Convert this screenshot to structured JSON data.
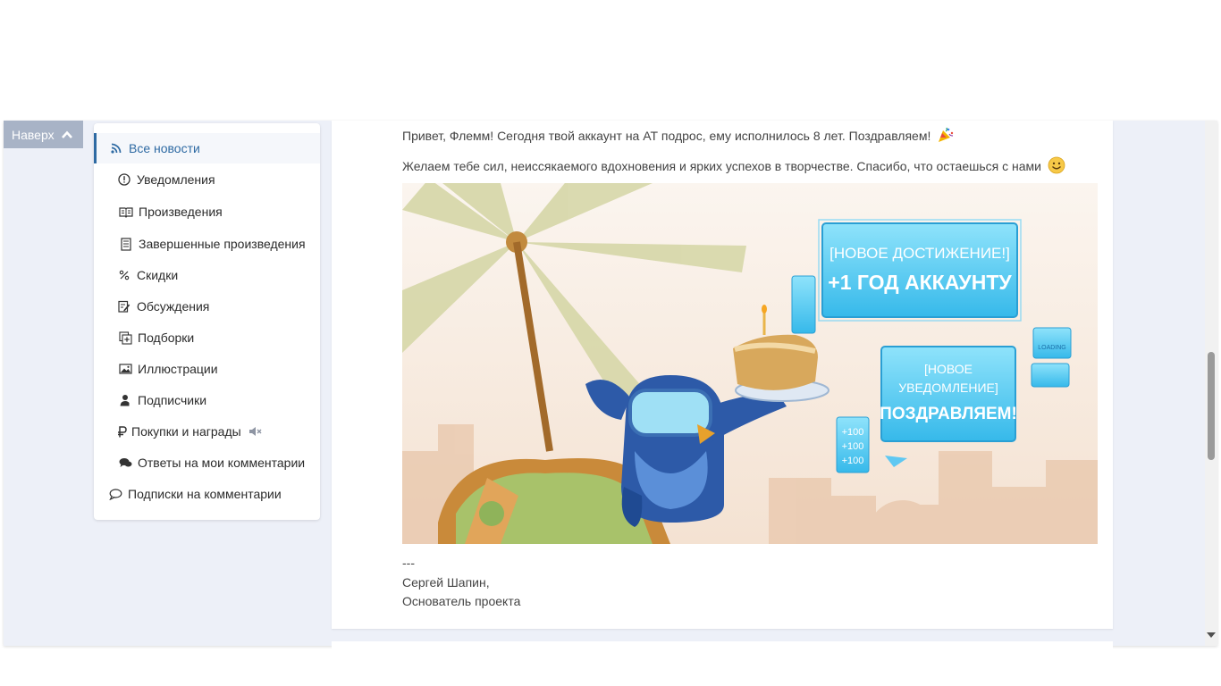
{
  "up_button": {
    "label": "Наверх"
  },
  "menu": {
    "items": [
      {
        "label": "Все новости",
        "icon": "rss-icon",
        "active": true
      },
      {
        "label": "Уведомления",
        "icon": "alert-circle-icon"
      },
      {
        "label": "Произведения",
        "icon": "open-book-icon"
      },
      {
        "label": "Завершенные произведения",
        "icon": "document-icon"
      },
      {
        "label": "Скидки",
        "icon": "percent-icon"
      },
      {
        "label": "Обсуждения",
        "icon": "edit-note-icon"
      },
      {
        "label": "Подборки",
        "icon": "collection-add-icon"
      },
      {
        "label": "Иллюстрации",
        "icon": "image-icon"
      },
      {
        "label": "Подписчики",
        "icon": "user-icon"
      },
      {
        "label": "Покупки и награды",
        "icon": "ruble-icon",
        "extra_icon": "muted-speaker-icon"
      },
      {
        "label": "Ответы на мои комментарии",
        "icon": "chat-bubbles-icon"
      },
      {
        "label": "Подписки на комментарии",
        "icon": "comment-icon"
      }
    ]
  },
  "post": {
    "line1": "Привет, Флемм! Сегодня твой аккаунт на АТ подрос, ему исполнилось 8 лет. Поздравляем!",
    "line1_emoji": "party-popper-icon",
    "line2": "Желаем тебе сил, неиссякаемого вдохновения и ярких успехов в творчестве. Спасибо, что остаешься с нами",
    "line2_emoji": "smile-emoji-icon",
    "illustration": {
      "banner1_line1": "[НОВОЕ ДОСТИЖЕНИЕ!]",
      "banner1_line2": "+1 ГОД АККАУНТУ",
      "banner2_line1": "[НОВОЕ",
      "banner2_line2": "УВЕДОМЛЕНИЕ]",
      "banner2_line3": "ПОЗДРАВЛЯЕМ!",
      "small_panel": [
        "+100",
        "+100",
        "+100"
      ],
      "loading_label": "LOADING"
    },
    "separator": "---",
    "signature_name": "Сергей Шапин,",
    "signature_role": "Основатель проекта"
  },
  "colors": {
    "accent": "#2e6aa3",
    "up_button_bg": "#a8b3c6",
    "page_bg": "#edf0f8"
  }
}
